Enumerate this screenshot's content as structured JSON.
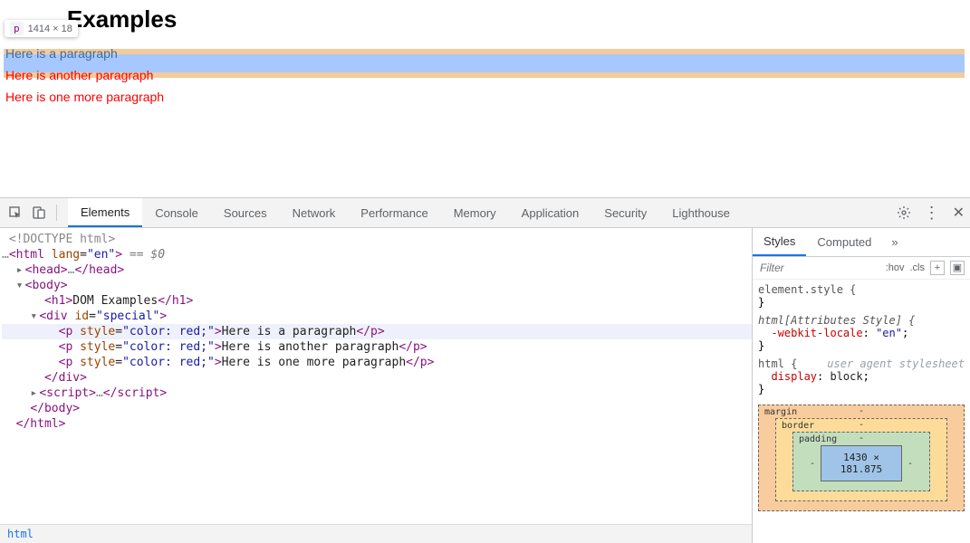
{
  "page": {
    "heading_visible": "Examples",
    "heading_full": "DOM Examples",
    "paragraphs": [
      "Here is a paragraph",
      "Here is another paragraph",
      "Here is one more paragraph"
    ],
    "inspect_badge": {
      "tag": "p",
      "dimensions": "1414 × 18"
    }
  },
  "devtools": {
    "tabs": [
      "Elements",
      "Console",
      "Sources",
      "Network",
      "Performance",
      "Memory",
      "Application",
      "Security",
      "Lighthouse"
    ],
    "active_tab": "Elements",
    "sidebar_tabs": [
      "Styles",
      "Computed"
    ],
    "active_sidebar_tab": "Styles",
    "filter_placeholder": "Filter",
    "filter_chips": {
      "hov": ":hov",
      "cls": ".cls"
    },
    "breadcrumb": "html"
  },
  "dom": {
    "doctype": "<!DOCTYPE html>",
    "html_open": "<html lang=\"en\">",
    "dollar": "== $0",
    "head": "<head>…</head>",
    "body_open": "<body>",
    "h1": {
      "open": "<h1>",
      "text": "DOM Examples",
      "close": "</h1>"
    },
    "div_open": "<div id=\"special\">",
    "p_lines": [
      {
        "open": "<p style=\"color: red;\">",
        "text": "Here is a paragraph",
        "close": "</p>"
      },
      {
        "open": "<p style=\"color: red;\">",
        "text": "Here is another paragraph",
        "close": "</p>"
      },
      {
        "open": "<p style=\"color: red;\">",
        "text": "Here is one more paragraph",
        "close": "</p>"
      }
    ],
    "div_close": "</div>",
    "script": "<script>…</scr",
    "script_tail": "ipt>",
    "body_close": "</body>",
    "html_close": "</html>"
  },
  "styles": {
    "rules": [
      {
        "selector": "element.style {",
        "props": [],
        "close": "}"
      },
      {
        "selector": "html[Attributes Style] {",
        "props": [
          {
            "name": "-webkit-locale",
            "value": "\"en\""
          }
        ],
        "close": "}"
      },
      {
        "selector": "html {",
        "ua": "user agent stylesheet",
        "props": [
          {
            "name": "display",
            "value": "block"
          }
        ],
        "close": "}"
      }
    ]
  },
  "box_model": {
    "margin": "margin",
    "border": "border",
    "padding": "padding",
    "content": "1430 × 181.875",
    "dash": "-"
  }
}
